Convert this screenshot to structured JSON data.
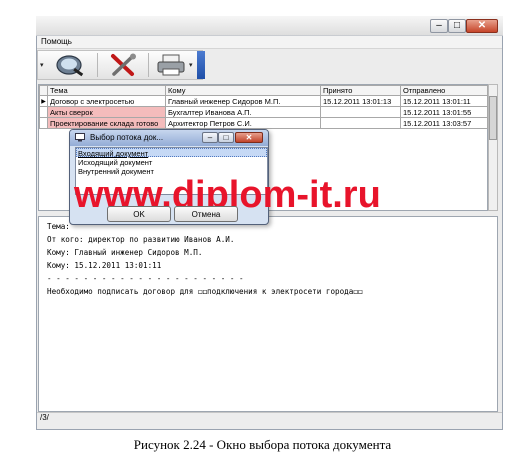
{
  "window": {
    "menu": [
      "Помощь"
    ],
    "status_text": "/3/"
  },
  "toolbar": {
    "buttons": [
      {
        "icon": "magnifier-icon"
      },
      {
        "icon": "tools-icon"
      },
      {
        "icon": "printer-icon"
      }
    ]
  },
  "grid": {
    "columns": [
      "Тема",
      "Кому",
      "Принято",
      "Отправлено"
    ],
    "rows": [
      {
        "indicator": "▶",
        "subject": "Договор с электросетью",
        "to": "Главный инженер Сидоров М.П.",
        "received": "15.12.2011 13:01:13",
        "sent": "15.12.2011 13:01:11",
        "highlight": false
      },
      {
        "indicator": "",
        "subject": "Акты сверок",
        "to": "Бухгалтер Иванова А.П.",
        "received": "",
        "sent": "15.12.2011 13:01:55",
        "highlight": true
      },
      {
        "indicator": "",
        "subject": "Проектирование склада готово",
        "to": "Архитектор Петров С.И.",
        "received": "",
        "sent": "15.12.2011 13:03:57",
        "highlight": true
      }
    ]
  },
  "message": {
    "lines": [
      "Тема:",
      "От кого: директор по развитию Иванов А.И.",
      "Кому: Главный инженер Сидоров М.П.",
      "Кому: 15.12.2011 13:01:11",
      "- - - - - - - - - - - - - - - - - - - - - -",
      "Необходимо подписать договор для ◻◻подключения к электросети города◻◻"
    ]
  },
  "dialog": {
    "title": "Выбор потока док...",
    "items": [
      "Входящий документ",
      "Исходящий документ",
      "Внутренний документ"
    ],
    "selected_index": 0,
    "ok_label": "OK",
    "cancel_label": "Отмена"
  },
  "watermark": "www.diplom-it.ru",
  "caption": "Рисунок 2.24 - Окно выбора потока документа",
  "colors": {
    "highlight_row": "#f4bcbc",
    "watermark": "#e8142b",
    "close_button": "#c6452a"
  }
}
